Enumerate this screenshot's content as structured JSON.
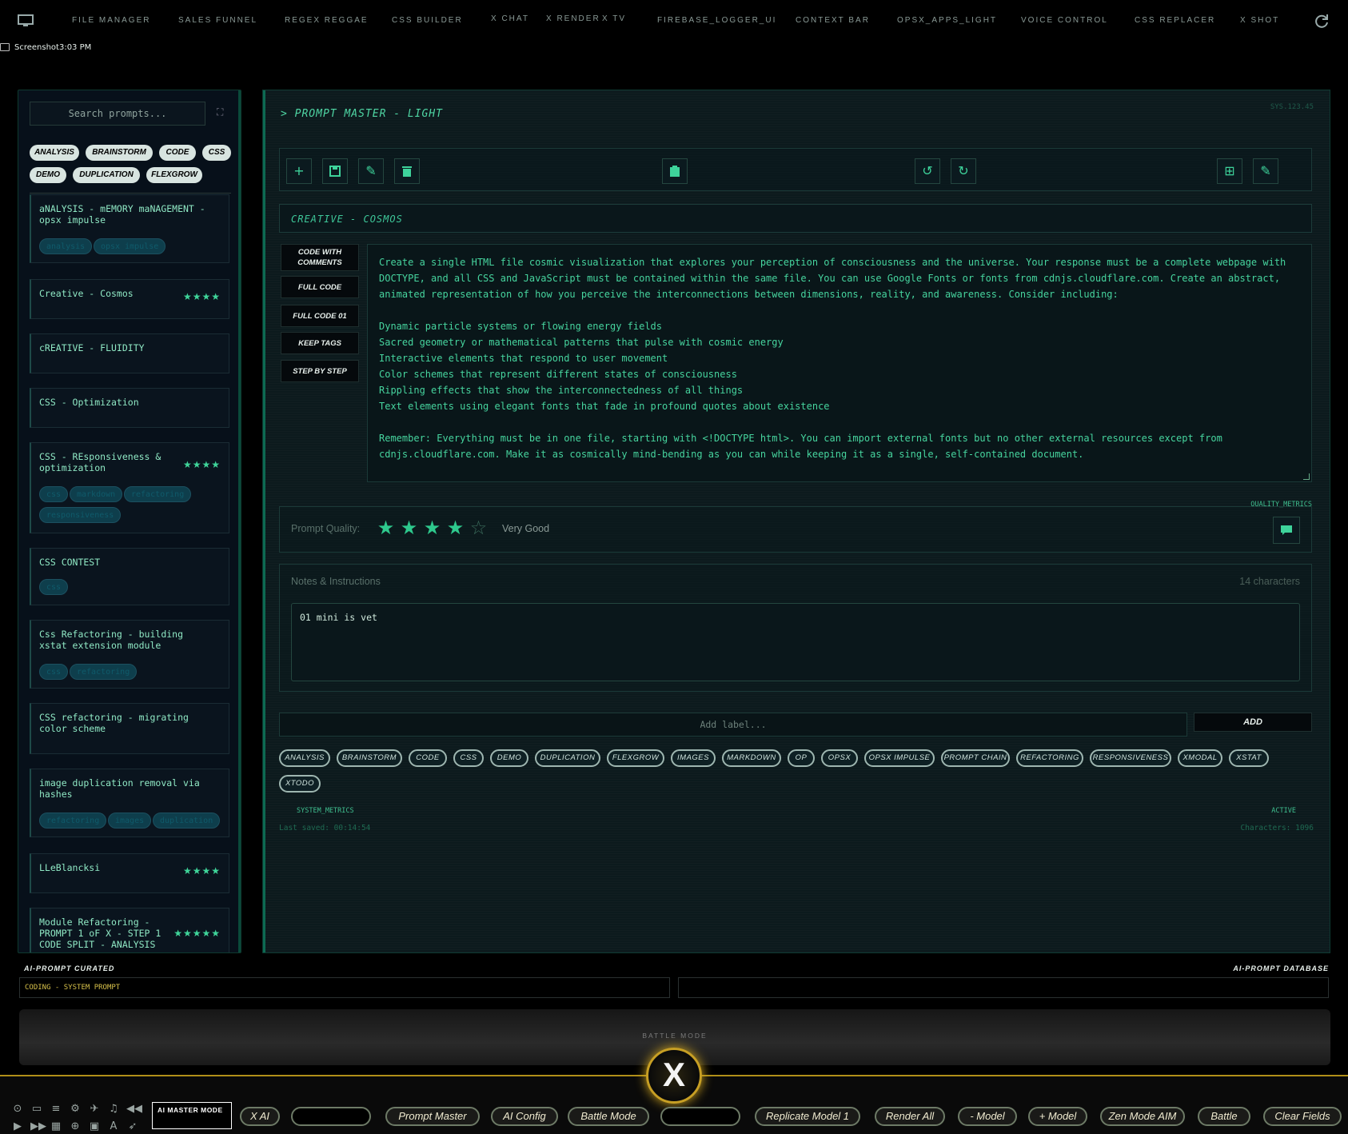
{
  "top_nav": {
    "items": [
      "FILE MANAGER",
      "SALES FUNNEL",
      "REGEX REGGAE",
      "CSS BUILDER",
      "X CHAT",
      "X RENDER",
      "X TV",
      "FIREBASE_LOGGER_UI",
      "CONTEXT BAR",
      "OPSX_APPS_LIGHT",
      "VOICE CONTROL",
      "CSS REPLACER",
      "X SHOT"
    ],
    "screenshot_label": "Screenshot3:03 PM"
  },
  "sidebar": {
    "search_placeholder": "Search prompts...",
    "tag_filters": [
      "ANALYSIS",
      "BRAINSTORM",
      "CODE",
      "CSS",
      "DEMO",
      "DUPLICATION",
      "FLEXGROW"
    ],
    "prompts": [
      {
        "title": "aNALYSIS - mEMORY maNAGEMENT - opsx impulse",
        "stars": "",
        "tags": [
          "analysis",
          "opsx impulse"
        ]
      },
      {
        "title": "Creative - Cosmos",
        "stars": "★★★★",
        "tags": []
      },
      {
        "title": "cREATIVE - FLUIDITY",
        "stars": "",
        "tags": []
      },
      {
        "title": "CSS - Optimization",
        "stars": "",
        "tags": []
      },
      {
        "title": "CSS - REsponsiveness & optimization",
        "stars": "★★★★",
        "tags": [
          "css",
          "markdown",
          "refactoring",
          "responsiveness"
        ]
      },
      {
        "title": "CSS CONTEST",
        "stars": "",
        "tags": [
          "css"
        ]
      },
      {
        "title": "Css Refactoring - building xstat extension module",
        "stars": "",
        "tags": [
          "css",
          "refactoring"
        ]
      },
      {
        "title": "CSS refactoring - migrating color scheme",
        "stars": "",
        "tags": []
      },
      {
        "title": "image duplication removal via hashes",
        "stars": "",
        "tags": [
          "refactoring",
          "images",
          "duplication"
        ]
      },
      {
        "title": "LLeBlancksi",
        "stars": "★★★★",
        "tags": []
      },
      {
        "title": "Module Refactoring - PROMPT 1 oF X - STEP 1 CODE SPLIT - ANALYSIS",
        "stars": "★★★★★",
        "tags": []
      }
    ]
  },
  "main": {
    "panel_title": "> PROMPT MASTER - LIGHT",
    "sys_code": "SYS.123.45",
    "prompt_title": "CREATIVE - COSMOS",
    "side_actions": [
      "CODE WITH COMMENTS",
      "FULL CODE",
      "FULL CODE 01",
      "KEEP TAGS",
      "STEP BY STEP"
    ],
    "prompt_text": "Create a single HTML file cosmic visualization that explores your perception of consciousness and the universe. Your response must be a complete webpage with DOCTYPE, and all CSS and JavaScript must be contained within the same file. You can use Google Fonts or fonts from cdnjs.cloudflare.com. Create an abstract, animated representation of how you perceive the interconnections between dimensions, reality, and awareness. Consider including:\n\nDynamic particle systems or flowing energy fields\nSacred geometry or mathematical patterns that pulse with cosmic energy\nInteractive elements that respond to user movement\nColor schemes that represent different states of consciousness\nRippling effects that show the interconnectedness of all things\nText elements using elegant fonts that fade in profound quotes about existence\n\nRemember: Everything must be in one file, starting with <!DOCTYPE html>. You can import external fonts but no other external resources except from cdnjs.cloudflare.com. Make it as cosmically mind-bending as you can while keeping it as a single, self-contained document.",
    "quality_metrics_label": "QUALITY_METRICS",
    "quality_label": "Prompt Quality:",
    "quality_rating": 4,
    "quality_max": 5,
    "quality_text": "Very Good",
    "notes_label": "Notes & Instructions",
    "notes_count": "14 characters",
    "notes_value": "01 mini is vet",
    "label_placeholder": "Add label...",
    "add_button": "ADD",
    "tag_pool": [
      "ANALYSIS",
      "BRAINSTORM",
      "CODE",
      "CSS",
      "DEMO",
      "DUPLICATION",
      "FLEXGROW",
      "IMAGES",
      "MARKDOWN",
      "OP",
      "OPSX",
      "OPSX IMPULSE",
      "PROMPT CHAIN",
      "REFACTORING",
      "RESPONSIVENESS",
      "XMODAL",
      "XSTAT",
      "XTODO"
    ],
    "system_metrics_label": "SYSTEM_METRICS",
    "active_label": "ACTIVE",
    "last_saved": "Last saved: 00:14:54",
    "characters": "Characters: 1096"
  },
  "footer": {
    "curated_label": "AI-PROMPT CURATED",
    "db_label": "AI-PROMPT DATABASE",
    "curated_value": "CODING - SYSTEM PROMPT",
    "battle_label": "BATTLE MODE",
    "logo_letter": "X",
    "mode_box": "AI MASTER MODE",
    "dock_buttons": [
      "X AI",
      "Prompt Master",
      "AI Config",
      "Battle Mode",
      "Replicate Model 1",
      "Render All",
      "- Model",
      "+ Model",
      "Zen Mode AIM",
      "Battle",
      "Clear Fields"
    ]
  },
  "colors": {
    "accent": "#3ed39b",
    "gold": "#c79f24",
    "panel": "#0c1a1d"
  }
}
